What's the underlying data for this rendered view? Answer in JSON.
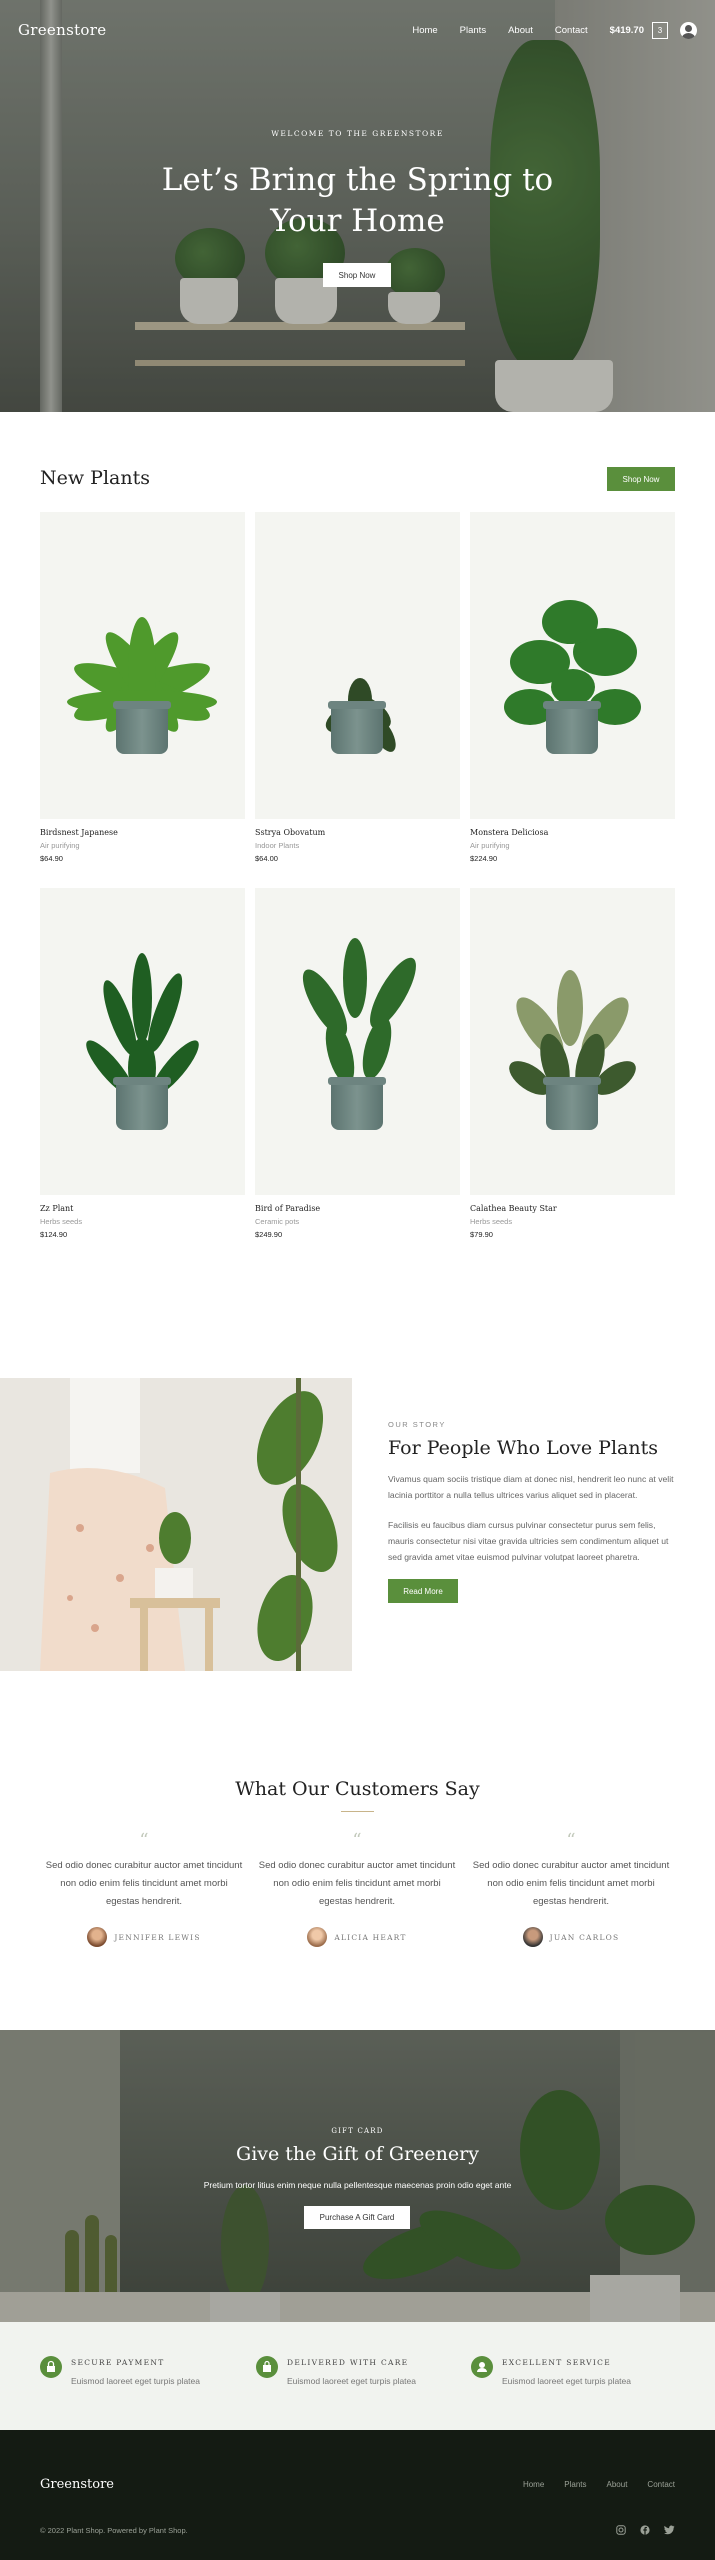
{
  "nav": {
    "logo": "Greenstore",
    "links": [
      "Home",
      "Plants",
      "About",
      "Contact"
    ],
    "cart_total": "$419.70",
    "cart_count": "3"
  },
  "hero": {
    "eyebrow": "WELCOME TO THE GREENSTORE",
    "title": "Let’s Bring the Spring to Your Home",
    "button": "Shop Now"
  },
  "new_plants": {
    "title": "New Plants",
    "button": "Shop Now",
    "products": [
      {
        "name": "Birdsnest Japanese",
        "category": "Air purifying",
        "price": "$64.90"
      },
      {
        "name": "Sstrya Obovatum",
        "category": "Indoor Plants",
        "price": "$64.00"
      },
      {
        "name": "Monstera Deliciosa",
        "category": "Air purifying",
        "price": "$224.90"
      },
      {
        "name": "Zz Plant",
        "category": "Herbs seeds",
        "price": "$124.90"
      },
      {
        "name": "Bird of Paradise",
        "category": "Ceramic pots",
        "price": "$249.90"
      },
      {
        "name": "Calathea Beauty Star",
        "category": "Herbs seeds",
        "price": "$79.90"
      }
    ]
  },
  "story": {
    "eyebrow": "OUR STORY",
    "title": "For People Who Love Plants",
    "p1": "Vivamus quam sociis tristique diam at donec nisl, hendrerit leo nunc at velit lacinia porttitor a nulla tellus ultrices varius aliquet sed in placerat.",
    "p2": "Facilisis eu faucibus diam cursus pulvinar consectetur purus sem felis, mauris consectetur nisi vitae gravida ultricies sem condimentum aliquet ut sed gravida amet vitae euismod pulvinar volutpat laoreet pharetra.",
    "button": "Read More"
  },
  "testimonials": {
    "title": "What Our Customers Say",
    "items": [
      {
        "text": "Sed odio donec curabitur auctor amet tincidunt non odio enim felis tincidunt amet morbi egestas hendrerit.",
        "name": "JENNIFER LEWIS"
      },
      {
        "text": "Sed odio donec curabitur auctor amet tincidunt non odio enim felis tincidunt amet morbi egestas hendrerit.",
        "name": "ALICIA HEART"
      },
      {
        "text": "Sed odio donec curabitur auctor amet tincidunt non odio enim felis tincidunt amet morbi egestas hendrerit.",
        "name": "JUAN CARLOS"
      }
    ]
  },
  "gift": {
    "eyebrow": "GIFT CARD",
    "title": "Give the Gift of Greenery",
    "text": "Pretium tortor litius enim neque nulla pellentesque maecenas proin odio eget ante",
    "button": "Purchase A Gift Card"
  },
  "features": [
    {
      "title": "SECURE PAYMENT",
      "desc": "Euismod laoreet eget turpis platea",
      "icon": "lock-icon"
    },
    {
      "title": "DELIVERED WITH CARE",
      "desc": "Euismod laoreet eget turpis platea",
      "icon": "bag-icon"
    },
    {
      "title": "EXCELLENT SERVICE",
      "desc": "Euismod laoreet eget turpis platea",
      "icon": "user-icon"
    }
  ],
  "footer": {
    "logo": "Greenstore",
    "links": [
      "Home",
      "Plants",
      "About",
      "Contact"
    ],
    "copyright": "© 2022 Plant Shop. Powered by Plant Shop.",
    "social": [
      "instagram-icon",
      "facebook-icon",
      "twitter-icon"
    ]
  },
  "colors": {
    "accent": "#5a8f3c",
    "footer_bg": "#141b13",
    "card_bg": "#f4f5f1",
    "feature_bg": "#f1f3ef"
  }
}
